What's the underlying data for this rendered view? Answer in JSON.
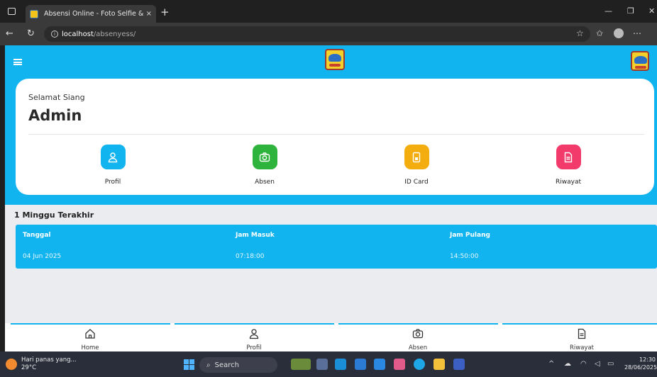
{
  "browser": {
    "tab_title": "Absensi Online - Foto Selfie & Ab",
    "tab_close": "×",
    "new_tab": "+",
    "url_host": "localhost",
    "url_path": "/absenyess/"
  },
  "header": {
    "greeting": "Selamat Siang",
    "user_name": "Admin"
  },
  "menu": [
    {
      "label": "Profil",
      "icon": "user-icon",
      "color": "#11b4ee"
    },
    {
      "label": "Absen",
      "icon": "camera-icon",
      "color": "#2eb33c"
    },
    {
      "label": "ID Card",
      "icon": "id-card-icon",
      "color": "#f3ad0f"
    },
    {
      "label": "Riwayat",
      "icon": "document-icon",
      "color": "#f23a6b"
    }
  ],
  "history": {
    "title": "1 Minggu Terakhir",
    "columns": [
      "Tanggal",
      "Jam Masuk",
      "Jam Pulang"
    ],
    "rows": [
      [
        "04 Jun 2025",
        "07:18:00",
        "14:50:00"
      ]
    ]
  },
  "bottom_nav": [
    {
      "label": "Home",
      "icon": "home-icon"
    },
    {
      "label": "Profil",
      "icon": "user-icon"
    },
    {
      "label": "Absen",
      "icon": "camera-icon"
    },
    {
      "label": "Riwayat",
      "icon": "document-icon"
    }
  ],
  "taskbar": {
    "weather_text": "Hari panas yang...",
    "temperature": "29°C",
    "search_label": "Search",
    "time": "12:30",
    "date": "28/06/2025"
  },
  "colors": {
    "accent": "#11b4ee",
    "background": "#ebecf0"
  }
}
